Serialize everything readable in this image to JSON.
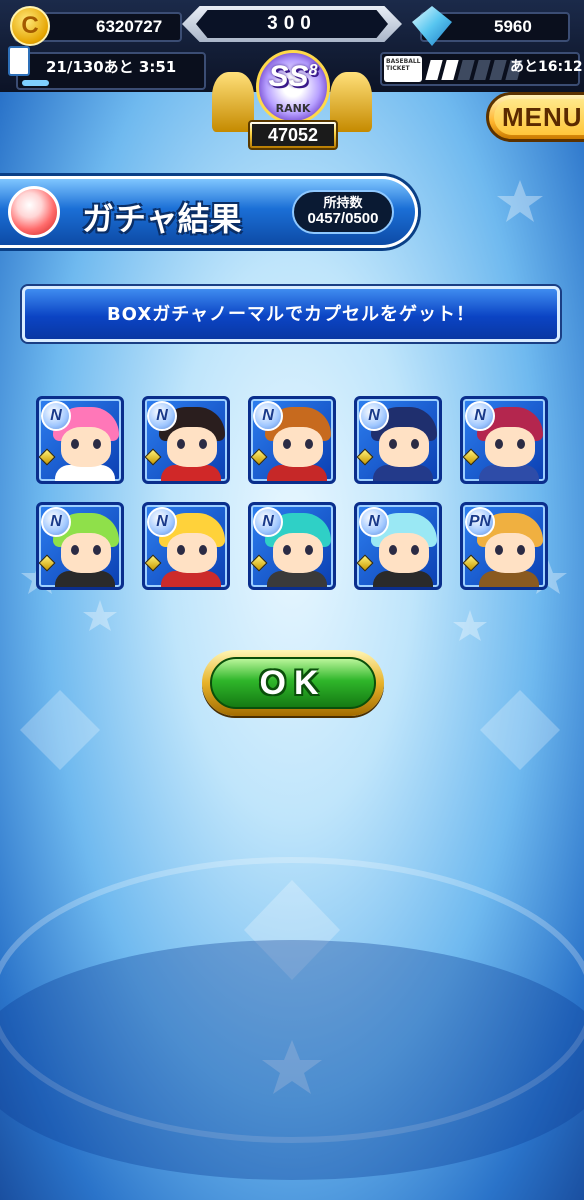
{
  "header": {
    "coins": "6320727",
    "center_value": "300",
    "gems": "5960",
    "stamina": "21/130あと 3:51",
    "stamina_fill": 0.16,
    "ticket_time": "あと16:12",
    "ticket_bars_filled": 2,
    "ticket_bars_total": 6,
    "rank_grade": "SS",
    "rank_sub": "8",
    "rank_label": "RANK",
    "rank_points": "47052",
    "menu_label": "MENU"
  },
  "title": {
    "text": "ガチャ結果",
    "count_label": "所持数",
    "count_value": "0457/0500"
  },
  "message": "BOXガチャノーマルでカプセルをゲット！",
  "cards": [
    {
      "badge": "N",
      "hair": "#ff77b8",
      "body": "#ffffff"
    },
    {
      "badge": "N",
      "hair": "#2a1e1e",
      "body": "#d02828"
    },
    {
      "badge": "N",
      "hair": "#c76a1e",
      "body": "#c62828"
    },
    {
      "badge": "N",
      "hair": "#1f2f6e",
      "body": "#233a8a"
    },
    {
      "badge": "N",
      "hair": "#b4264e",
      "body": "#2e4ca8"
    },
    {
      "badge": "N",
      "hair": "#8fe04a",
      "body": "#2a2a2a"
    },
    {
      "badge": "N",
      "hair": "#ffd23a",
      "body": "#cc2b2b"
    },
    {
      "badge": "N",
      "hair": "#2fd0c6",
      "body": "#3a3a3a"
    },
    {
      "badge": "N",
      "hair": "#9ae8f4",
      "body": "#2a2a2a"
    },
    {
      "badge": "PN",
      "hair": "#f0b040",
      "body": "#8a5a20"
    }
  ],
  "ok_label": "OK",
  "ticket_icon_text": "BASEBALL TICKET"
}
